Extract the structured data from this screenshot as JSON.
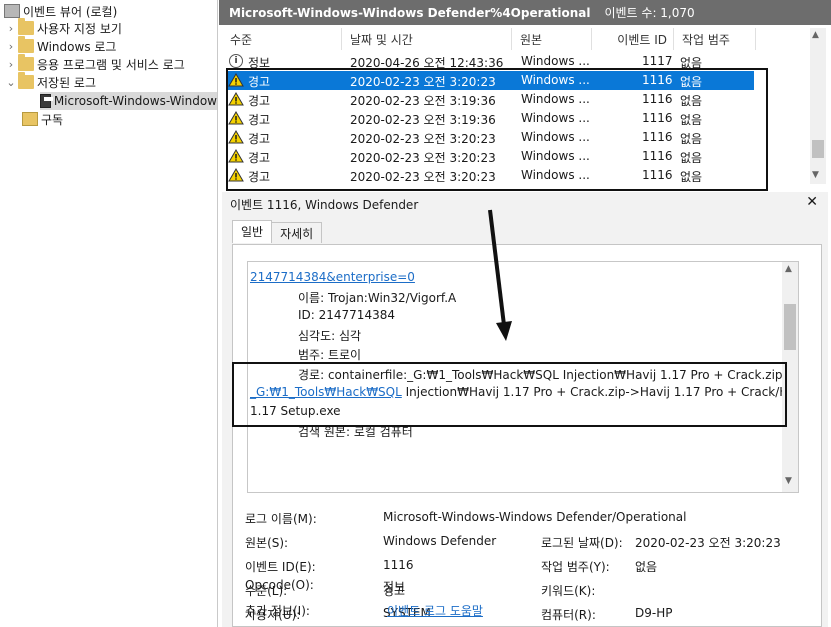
{
  "tree": {
    "items": [
      {
        "label": "이벤트 뷰어 (로컬)"
      },
      {
        "label": "사용자 지정 보기"
      },
      {
        "label": "Windows 로그"
      },
      {
        "label": "응용 프로그램 및 서비스 로그"
      },
      {
        "label": "저장된 로그"
      },
      {
        "label": "Microsoft-Windows-Window"
      },
      {
        "label": "구독"
      }
    ]
  },
  "header": {
    "title": "Microsoft-Windows-Windows Defender%4Operational",
    "count": "이벤트 수: 1,070"
  },
  "table": {
    "columns": [
      "수준",
      "날짜 및 시간",
      "원본",
      "이벤트 ID",
      "작업 범주"
    ],
    "rows": [
      {
        "level": "정보",
        "date": "2020-04-26 오전 12:43:36",
        "source": "Windows ...",
        "id": "1117",
        "category": "없음"
      },
      {
        "level": "경고",
        "date": "2020-02-23 오전 3:20:23",
        "source": "Windows ...",
        "id": "1116",
        "category": "없음"
      },
      {
        "level": "경고",
        "date": "2020-02-23 오전 3:19:36",
        "source": "Windows ...",
        "id": "1116",
        "category": "없음"
      },
      {
        "level": "경고",
        "date": "2020-02-23 오전 3:19:36",
        "source": "Windows ...",
        "id": "1116",
        "category": "없음"
      },
      {
        "level": "경고",
        "date": "2020-02-23 오전 3:20:23",
        "source": "Windows ...",
        "id": "1116",
        "category": "없음"
      },
      {
        "level": "경고",
        "date": "2020-02-23 오전 3:20:23",
        "source": "Windows ...",
        "id": "1116",
        "category": "없음"
      },
      {
        "level": "경고",
        "date": "2020-02-23 오전 3:20:23",
        "source": "Windows ...",
        "id": "1116",
        "category": "없음"
      }
    ]
  },
  "detail": {
    "title": "이벤트 1116, Windows Defender",
    "close": "✕",
    "tabs": [
      "일반",
      "자세히"
    ],
    "text": {
      "l0": "2147714384&enterprise=0",
      "l1": "이름: Trojan:Win32/Vigorf.A",
      "l2": "ID: 2147714384",
      "l3": "심각도: 심각",
      "l4": "범주: 트로이",
      "l5a": "경로: containerfile:_G:₩1_Tools₩Hack₩SQL Injection₩Havij 1.17 Pro + Crack.zip;",
      "l5b": "file:",
      "l6a": "_G:₩1_Tools₩Hack₩SQL",
      "l6b": " Injection₩Havij 1.17 Pro + Crack.zip->Havij 1.17 Pro + Crack/Havij",
      "l7": "1.17 Setup.exe",
      "l8": "검색 원본: 로컬 검퓨터"
    },
    "props": {
      "logname_label": "로그 이름(M):",
      "logname_value": "Microsoft-Windows-Windows Defender/Operational",
      "source_label": "원본(S):",
      "source_value": "Windows Defender",
      "logged_label": "로그된 날짜(D):",
      "logged_value": "2020-02-23 오전 3:20:23",
      "eventid_label": "이벤트 ID(E):",
      "eventid_value": "1116",
      "task_label": "작업 범주(Y):",
      "task_value": "없음",
      "level_label": "수준(L):",
      "level_value": "경고",
      "keyword_label": "키워드(K):",
      "user_label": "사용자(U):",
      "user_value": "SYSTEM",
      "computer_label": "컴퓨터(R):",
      "computer_value": "D9-HP",
      "opcode_label": "Opcode(O):",
      "opcode_value": "정보",
      "more_label": "추가 정보(I):",
      "more_link": "이벤트 로그 도움말"
    }
  },
  "icons": {
    "warning": "warning-icon",
    "info": "info-icon",
    "folder": "folder-icon",
    "log": "saved-log-icon"
  }
}
